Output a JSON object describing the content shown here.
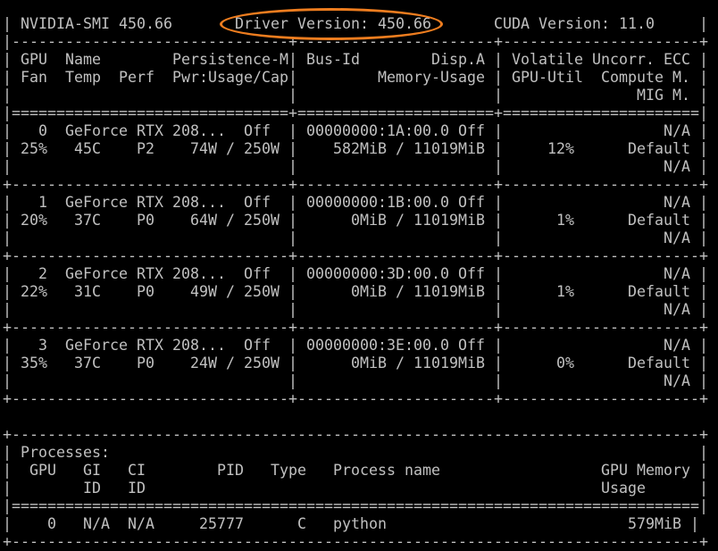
{
  "terminal": {
    "text_color": "#c0c0c0",
    "background": "#000000",
    "annotation_color": "#ee7d1f",
    "lines": [
      "| NVIDIA-SMI 450.66       Driver Version: 450.66       CUDA Version: 11.0     |",
      "|-------------------------------+----------------------+----------------------+",
      "| GPU  Name        Persistence-M| Bus-Id        Disp.A | Volatile Uncorr. ECC |",
      "| Fan  Temp  Perf  Pwr:Usage/Cap|         Memory-Usage | GPU-Util  Compute M. |",
      "|                               |                      |               MIG M. |",
      "|===============================+======================+======================|",
      "|   0  GeForce RTX 208...  Off  | 00000000:1A:00.0 Off |                  N/A |",
      "| 25%   45C    P2    74W / 250W |    582MiB / 11019MiB |     12%      Default |",
      "|                               |                      |                  N/A |",
      "+-------------------------------+----------------------+----------------------+",
      "|   1  GeForce RTX 208...  Off  | 00000000:1B:00.0 Off |                  N/A |",
      "| 20%   37C    P0    64W / 250W |      0MiB / 11019MiB |      1%      Default |",
      "|                               |                      |                  N/A |",
      "+-------------------------------+----------------------+----------------------+",
      "|   2  GeForce RTX 208...  Off  | 00000000:3D:00.0 Off |                  N/A |",
      "| 22%   31C    P0    49W / 250W |      0MiB / 11019MiB |      1%      Default |",
      "|                               |                      |                  N/A |",
      "+-------------------------------+----------------------+----------------------+",
      "|   3  GeForce RTX 208...  Off  | 00000000:3E:00.0 Off |                  N/A |",
      "| 35%   37C    P0    24W / 250W |      0MiB / 11019MiB |      0%      Default |",
      "|                               |                      |                  N/A |",
      "+-------------------------------+----------------------+----------------------+",
      "",
      "+-----------------------------------------------------------------------------+",
      "| Processes:                                                                  |",
      "|  GPU   GI   CI        PID   Type   Process name                  GPU Memory |",
      "|        ID   ID                                                   Usage      |",
      "|=============================================================================|",
      "|    0   N/A  N/A     25777      C   python                           579MiB |",
      "+-----------------------------------------------------------------------------+"
    ]
  }
}
